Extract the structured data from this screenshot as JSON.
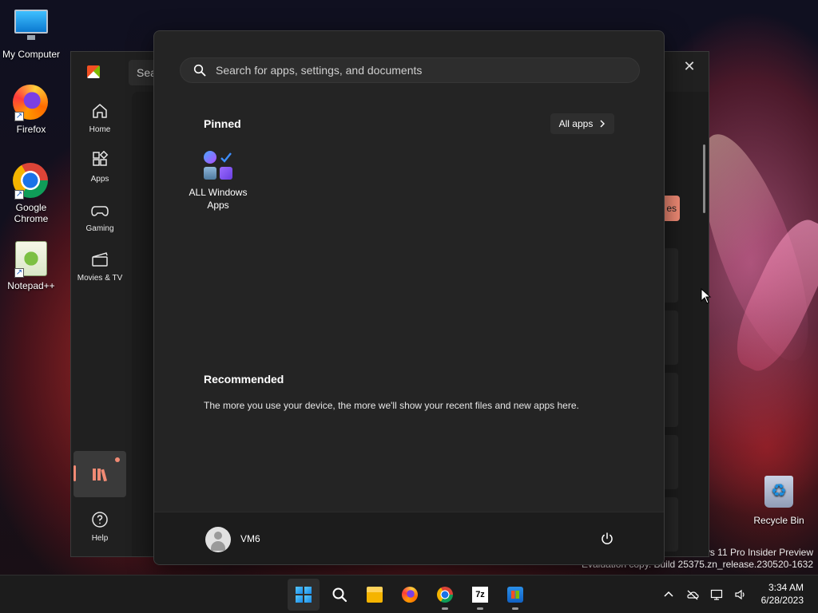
{
  "desktop": {
    "icons": [
      {
        "label": "My Computer",
        "icon": "monitor-icon"
      },
      {
        "label": "Firefox",
        "icon": "firefox-icon"
      },
      {
        "label": "Google Chrome",
        "icon": "chrome-icon"
      },
      {
        "label": "Notepad++",
        "icon": "notepad-plus-plus-icon"
      },
      {
        "label": "Recycle Bin",
        "icon": "recycle-bin-icon"
      }
    ],
    "watermark": {
      "line1": "ws 11 Pro Insider Preview",
      "line2": "Evaluation copy. Build 25375.zn_release.230520-1632"
    }
  },
  "store_window": {
    "search_stub": "Sea",
    "nav": [
      {
        "label": "Home",
        "icon": "home-icon"
      },
      {
        "label": "Apps",
        "icon": "apps-icon"
      },
      {
        "label": "Gaming",
        "icon": "gamepad-icon"
      },
      {
        "label": "Movies & TV",
        "icon": "clapperboard-icon"
      }
    ],
    "help_label": "Help",
    "badge_text": "es",
    "accent": "#f08a74"
  },
  "start_menu": {
    "search_placeholder": "Search for apps, settings, and documents",
    "pinned_title": "Pinned",
    "all_apps_label": "All apps",
    "pinned_apps": [
      {
        "label": "ALL Windows Apps"
      }
    ],
    "recommended_title": "Recommended",
    "recommended_text": "The more you use your device, the more we'll show your recent files and new apps here.",
    "user_name": "VM6"
  },
  "taskbar": {
    "items": [
      {
        "name": "start",
        "icon": "windows-logo-icon",
        "active": true
      },
      {
        "name": "search",
        "icon": "search-icon"
      },
      {
        "name": "file-explorer",
        "icon": "folder-icon"
      },
      {
        "name": "firefox",
        "icon": "firefox-icon"
      },
      {
        "name": "chrome",
        "icon": "chrome-icon"
      },
      {
        "name": "7-zip",
        "icon": "7zip-icon",
        "label": "7z"
      },
      {
        "name": "microsoft-store",
        "icon": "store-icon"
      }
    ],
    "clock": {
      "time": "3:34 AM",
      "date": "6/28/2023"
    },
    "accent": "#4cc2ff"
  }
}
